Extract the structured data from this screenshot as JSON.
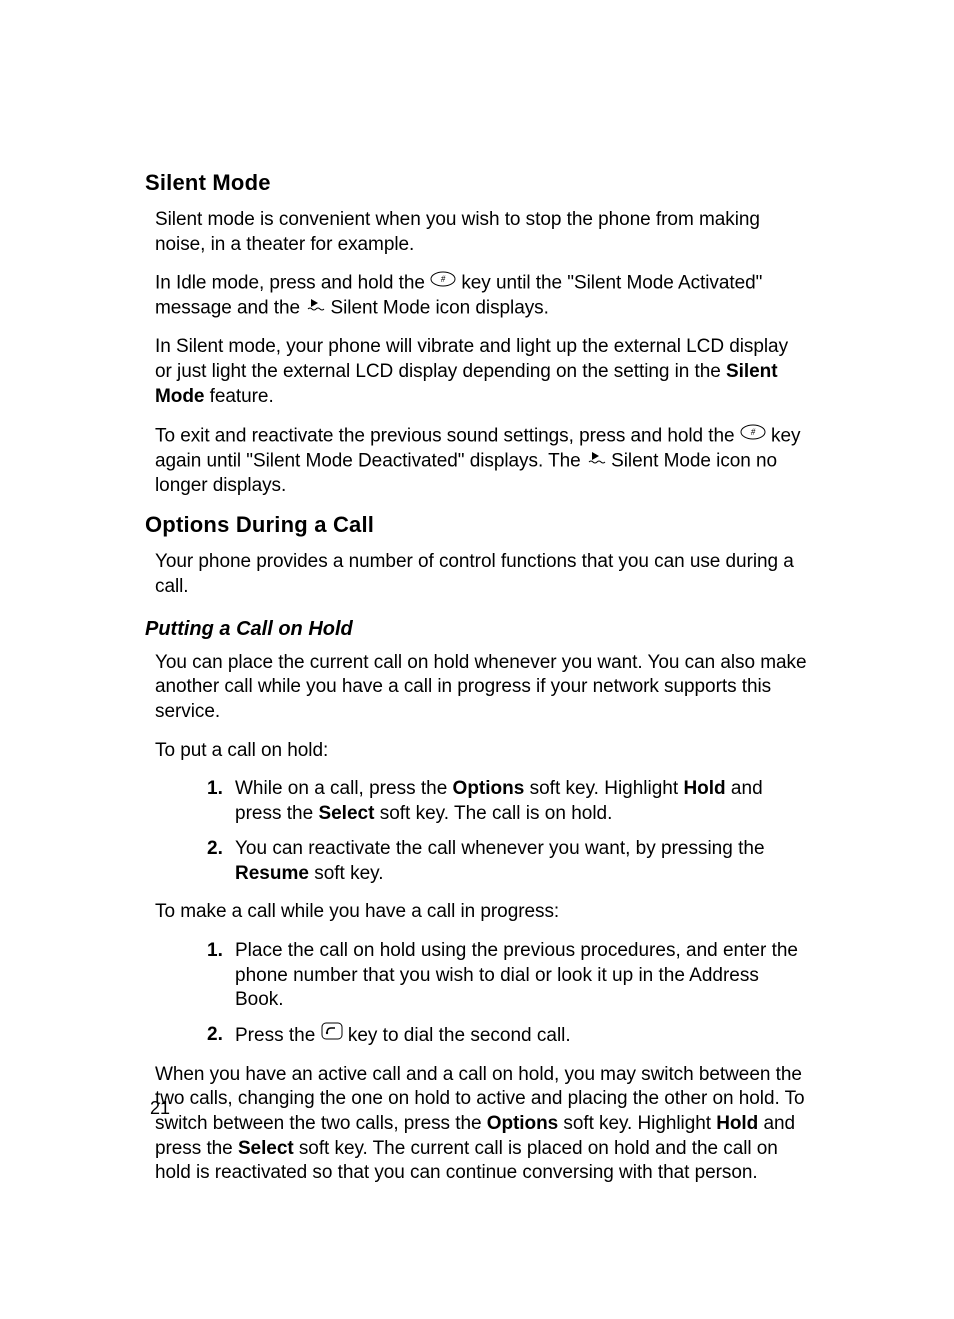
{
  "page_number": "21",
  "sections": {
    "silent_mode": {
      "heading": "Silent Mode",
      "p1": "Silent mode is convenient when you wish to stop the phone from making noise, in a theater for example.",
      "p2_a": "In Idle mode, press and hold the ",
      "p2_b": " key until the \"Silent Mode Activated\" message and the ",
      "p2_c": " Silent Mode icon displays.",
      "p3_a": "In Silent mode, your phone will vibrate and light up the external LCD display or just light the external LCD display depending on the setting in the ",
      "p3_bold": "Silent Mode",
      "p3_b": " feature.",
      "p4_a": "To exit and reactivate the previous sound settings, press and hold the ",
      "p4_b": " key again until \"Silent Mode Deactivated\" displays. The ",
      "p4_c": " Silent Mode icon no longer displays."
    },
    "options_during_call": {
      "heading": "Options During a Call",
      "p1": "Your phone provides a number of control functions that you can use during a call."
    },
    "putting_on_hold": {
      "heading": "Putting a Call on Hold",
      "p1": "You can place the current call on hold whenever you want. You can also make another call while you have a call in progress if your network supports this service.",
      "p2": "To put a call on hold:",
      "list1": {
        "item1_a": "While on a call, press the ",
        "item1_b1": "Options",
        "item1_c": " soft key. Highlight ",
        "item1_b2": "Hold",
        "item1_d": " and press the ",
        "item1_b3": "Select",
        "item1_e": " soft key. The call is on hold.",
        "item2_a": "You can reactivate the call whenever you want, by pressing the ",
        "item2_b1": "Resume",
        "item2_c": " soft key."
      },
      "p3": "To make a call while you have a call in progress:",
      "list2": {
        "item1": "Place the call on hold using the previous procedures, and enter the phone number that you wish to dial or look it up in the Address Book.",
        "item2_a": "Press the ",
        "item2_b": " key to dial the second call."
      },
      "p4_a": "When you have an active call and a call on hold, you may switch between the two calls, changing the one on hold to active and placing the other on hold. To switch between the two calls, press the ",
      "p4_b1": "Options",
      "p4_b": " soft key. Highlight ",
      "p4_b2": "Hold",
      "p4_c": " and press the ",
      "p4_b3": "Select",
      "p4_d": " soft key. The current call is placed on hold and the call on hold is reactivated so that you can continue conversing with that person."
    }
  }
}
